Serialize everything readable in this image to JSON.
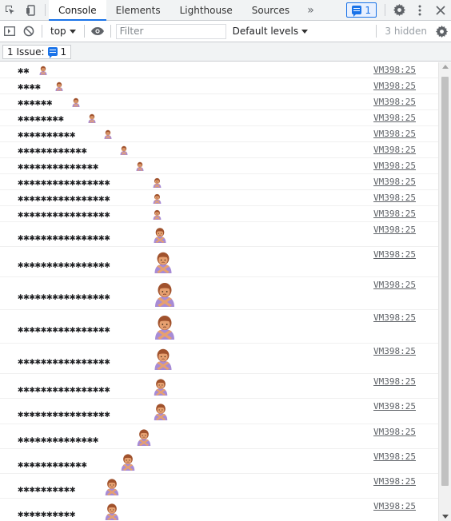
{
  "tabs": [
    {
      "label": "Console",
      "active": true
    },
    {
      "label": "Elements",
      "active": false
    },
    {
      "label": "Lighthouse",
      "active": false
    },
    {
      "label": "Sources",
      "active": false
    }
  ],
  "more_tabs_label": "»",
  "issues_count": "1",
  "toolbar": {
    "context": "top",
    "filter_placeholder": "Filter",
    "levels": "Default levels",
    "hidden": "3 hidden"
  },
  "issue_bar": {
    "label": "1 Issue:",
    "count": "1"
  },
  "colors": {
    "accent": "#1a73e8",
    "emoji_shirt": "#a78bd6",
    "emoji_skin": "#e6a070",
    "emoji_hair": "#a0522d"
  },
  "log_rows": [
    {
      "text": "✱✱",
      "source": "VM398:25"
    },
    {
      "text": "✱✱✱✱",
      "source": "VM398:25"
    },
    {
      "text": "✱✱✱✱✱✱",
      "source": "VM398:25"
    },
    {
      "text": "✱✱✱✱✱✱✱✱",
      "source": "VM398:25"
    },
    {
      "text": "✱✱✱✱✱✱✱✱✱✱",
      "source": "VM398:25"
    },
    {
      "text": "✱✱✱✱✱✱✱✱✱✱✱✱",
      "source": "VM398:25"
    },
    {
      "text": "✱✱✱✱✱✱✱✱✱✱✱✱✱✱",
      "source": "VM398:25"
    },
    {
      "text": "✱✱✱✱✱✱✱✱✱✱✱✱✱✱✱✱",
      "source": "VM398:25"
    },
    {
      "text": "✱✱✱✱✱✱✱✱✱✱✱✱✱✱✱✱",
      "source": "VM398:25"
    },
    {
      "text": "✱✱✱✱✱✱✱✱✱✱✱✱✱✱✱✱",
      "source": "VM398:25"
    },
    {
      "text": "✱✱✱✱✱✱✱✱✱✱✱✱✱✱✱✱",
      "source": "VM398:25"
    },
    {
      "text": "✱✱✱✱✱✱✱✱✱✱✱✱✱✱✱✱",
      "source": "VM398:25"
    },
    {
      "text": "✱✱✱✱✱✱✱✱✱✱✱✱✱✱✱✱",
      "source": "VM398:25"
    },
    {
      "text": "✱✱✱✱✱✱✱✱✱✱✱✱✱✱✱✱",
      "source": "VM398:25"
    },
    {
      "text": "✱✱✱✱✱✱✱✱✱✱✱✱✱✱✱✱",
      "source": "VM398:25"
    },
    {
      "text": "✱✱✱✱✱✱✱✱✱✱✱✱✱✱✱✱",
      "source": "VM398:25"
    },
    {
      "text": "✱✱✱✱✱✱✱✱✱✱✱✱✱✱✱✱",
      "source": "VM398:25"
    },
    {
      "text": "✱✱✱✱✱✱✱✱✱✱✱✱✱✱",
      "source": "VM398:25"
    },
    {
      "text": "✱✱✱✱✱✱✱✱✱✱✱✱",
      "source": "VM398:25"
    },
    {
      "text": "✱✱✱✱✱✱✱✱✱✱",
      "source": "VM398:25"
    },
    {
      "text": "✱✱✱✱✱✱✱✱✱✱",
      "source": "VM398:25"
    }
  ]
}
